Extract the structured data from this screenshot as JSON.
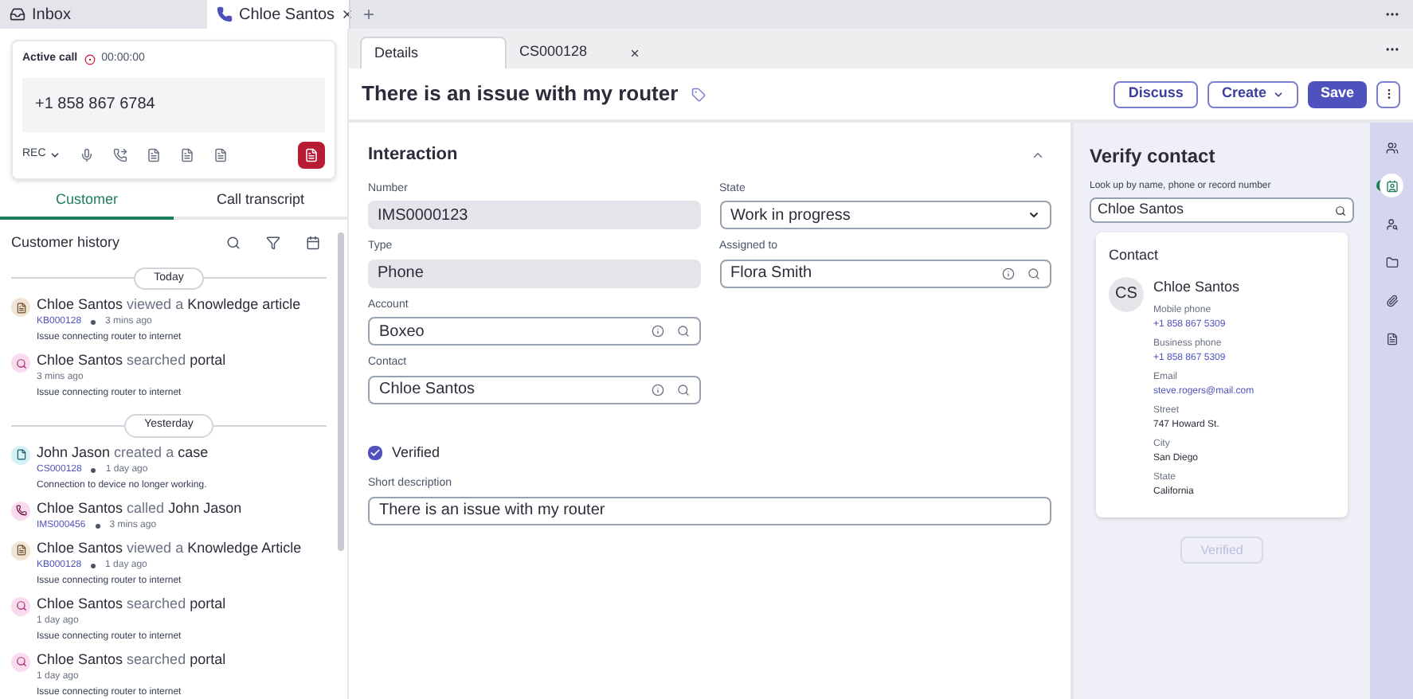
{
  "workspace_tabs": [
    {
      "label": "Inbox",
      "selected": false,
      "closable": false
    },
    {
      "label": "Chloe Santos",
      "selected": true,
      "closable": true
    }
  ],
  "new_tab": "+",
  "call": {
    "status": "Active call",
    "timer": "00:00:00",
    "number": "+1 858 867 6784",
    "rec": "REC"
  },
  "panel_tabs": [
    {
      "label": "Customer",
      "selected": true
    },
    {
      "label": "Call transcript",
      "selected": false
    }
  ],
  "history": {
    "title": "Customer history",
    "groups": [
      {
        "label": "Today",
        "items": [
          {
            "kind": "article",
            "text": "**Chloe Santos** viewed a **Knowledge article**",
            "link": "KB000128",
            "time": "3 mins ago",
            "desc": "Issue connecting router to internet"
          },
          {
            "kind": "search",
            "text": "**Chloe Santos** searched **portal**",
            "time": "3 mins ago",
            "desc": "Issue connecting router to internet"
          }
        ]
      },
      {
        "label": "Yesterday",
        "items": [
          {
            "kind": "case",
            "text": "**John Jason** created a **case**",
            "link": "CS000128",
            "time": "1 day ago",
            "desc": "Connection to device no longer working."
          },
          {
            "kind": "call",
            "text": "**Chloe Santos** called **John Jason**",
            "link": "IMS000456",
            "time": "3 mins ago"
          },
          {
            "kind": "article",
            "text": "**Chloe Santos** viewed a **Knowledge Article**",
            "link": "KB000128",
            "time": "1 day ago",
            "desc": "Issue connecting router to internet"
          },
          {
            "kind": "search",
            "text": "**Chloe Santos** searched **portal**",
            "time": "1 day ago",
            "desc": "Issue connecting router to internet"
          },
          {
            "kind": "search",
            "text": "**Chloe Santos** searched **portal**",
            "time": "1 day ago",
            "desc": "Issue connecting router to internet"
          }
        ]
      }
    ]
  },
  "record_tabs": [
    {
      "label": "Details",
      "selected": true,
      "closable": false
    },
    {
      "label": "CS000128",
      "selected": false,
      "closable": true
    }
  ],
  "record": {
    "title": "There is an issue with my router",
    "buttons": [
      {
        "label": "Discuss",
        "kind": "outline"
      },
      {
        "label": "Create",
        "kind": "menu"
      },
      {
        "label": "Save",
        "kind": "primary"
      }
    ]
  },
  "section": {
    "title": "Interaction",
    "expanded": true
  },
  "fields_left": [
    {
      "label": "Number",
      "value": "IMS0000123",
      "kind": "readonly"
    },
    {
      "label": "Type",
      "value": "Phone",
      "kind": "readonly"
    },
    {
      "label": "Account",
      "value": "Boxeo",
      "kind": "reference"
    },
    {
      "label": "Contact",
      "value": "Chloe Santos",
      "kind": "reference"
    }
  ],
  "fields_right": [
    {
      "label": "State",
      "value": "Work in progress",
      "kind": "select"
    },
    {
      "label": "Assigned to",
      "value": "Flora Smith",
      "kind": "reference"
    }
  ],
  "verified": {
    "label": "Verified",
    "checked": true
  },
  "short_description": {
    "label": "Short description",
    "value": "There is an issue with my router"
  },
  "verify": {
    "title": "Verify contact",
    "lookup_label": "Look up by name, phone or record number",
    "lookup_value": "Chloe Santos",
    "card_title": "Contact",
    "initials": "CS",
    "name": "Chloe Santos",
    "details": [
      {
        "label": "Mobile phone",
        "value": "+1 858 867 5309",
        "link": true
      },
      {
        "label": "Business phone",
        "value": "+1 858 867 5309",
        "link": true
      },
      {
        "label": "Email",
        "value": "steve.rogers@mail.com",
        "link": true
      },
      {
        "label": "Street",
        "value": "747 Howard St.",
        "link": false
      },
      {
        "label": "City",
        "value": "San Diego",
        "link": false
      },
      {
        "label": "State",
        "value": "California",
        "link": false
      }
    ],
    "button": {
      "label": "Verified",
      "disabled": true
    }
  },
  "rail": [
    {
      "selected": false
    },
    {
      "selected": true
    },
    {
      "selected": false
    },
    {
      "selected": false
    },
    {
      "selected": false
    },
    {
      "selected": false
    }
  ]
}
